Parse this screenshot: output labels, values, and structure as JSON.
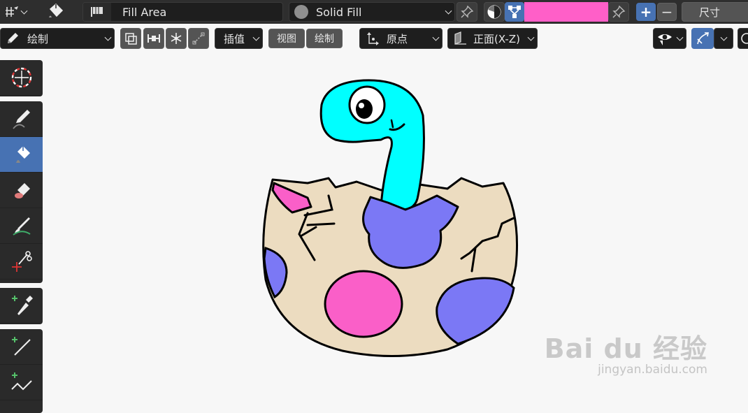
{
  "header": {
    "fill_material_label": "Fill Area",
    "fill_style_label": "Solid Fill",
    "vertex_color": "#ff5fc8",
    "size_label": "尺寸",
    "plus_label": "+",
    "minus_label": "−"
  },
  "subheader": {
    "mode_label": "绘制",
    "interpolate_label": "插值",
    "view_label": "视图",
    "draw_label": "绘制",
    "origin_label": "原点",
    "orientation_label": "正面(X-Z)"
  },
  "toolbar": {
    "tools": [
      "cursor",
      "draw",
      "fill",
      "erase",
      "tint",
      "cutter",
      "eyedropper",
      "line",
      "polyline"
    ],
    "active_tool": "fill",
    "active_color": "#4772b3"
  },
  "artwork": {
    "colors": {
      "body": "#00ffff",
      "shell": "#ecdcc0",
      "pink": "#fa5fc8",
      "purple": "#7b78f5",
      "outline": "#000000"
    }
  },
  "watermark": {
    "logo": "Bai du 经验",
    "url": "jingyan.baidu.com"
  }
}
